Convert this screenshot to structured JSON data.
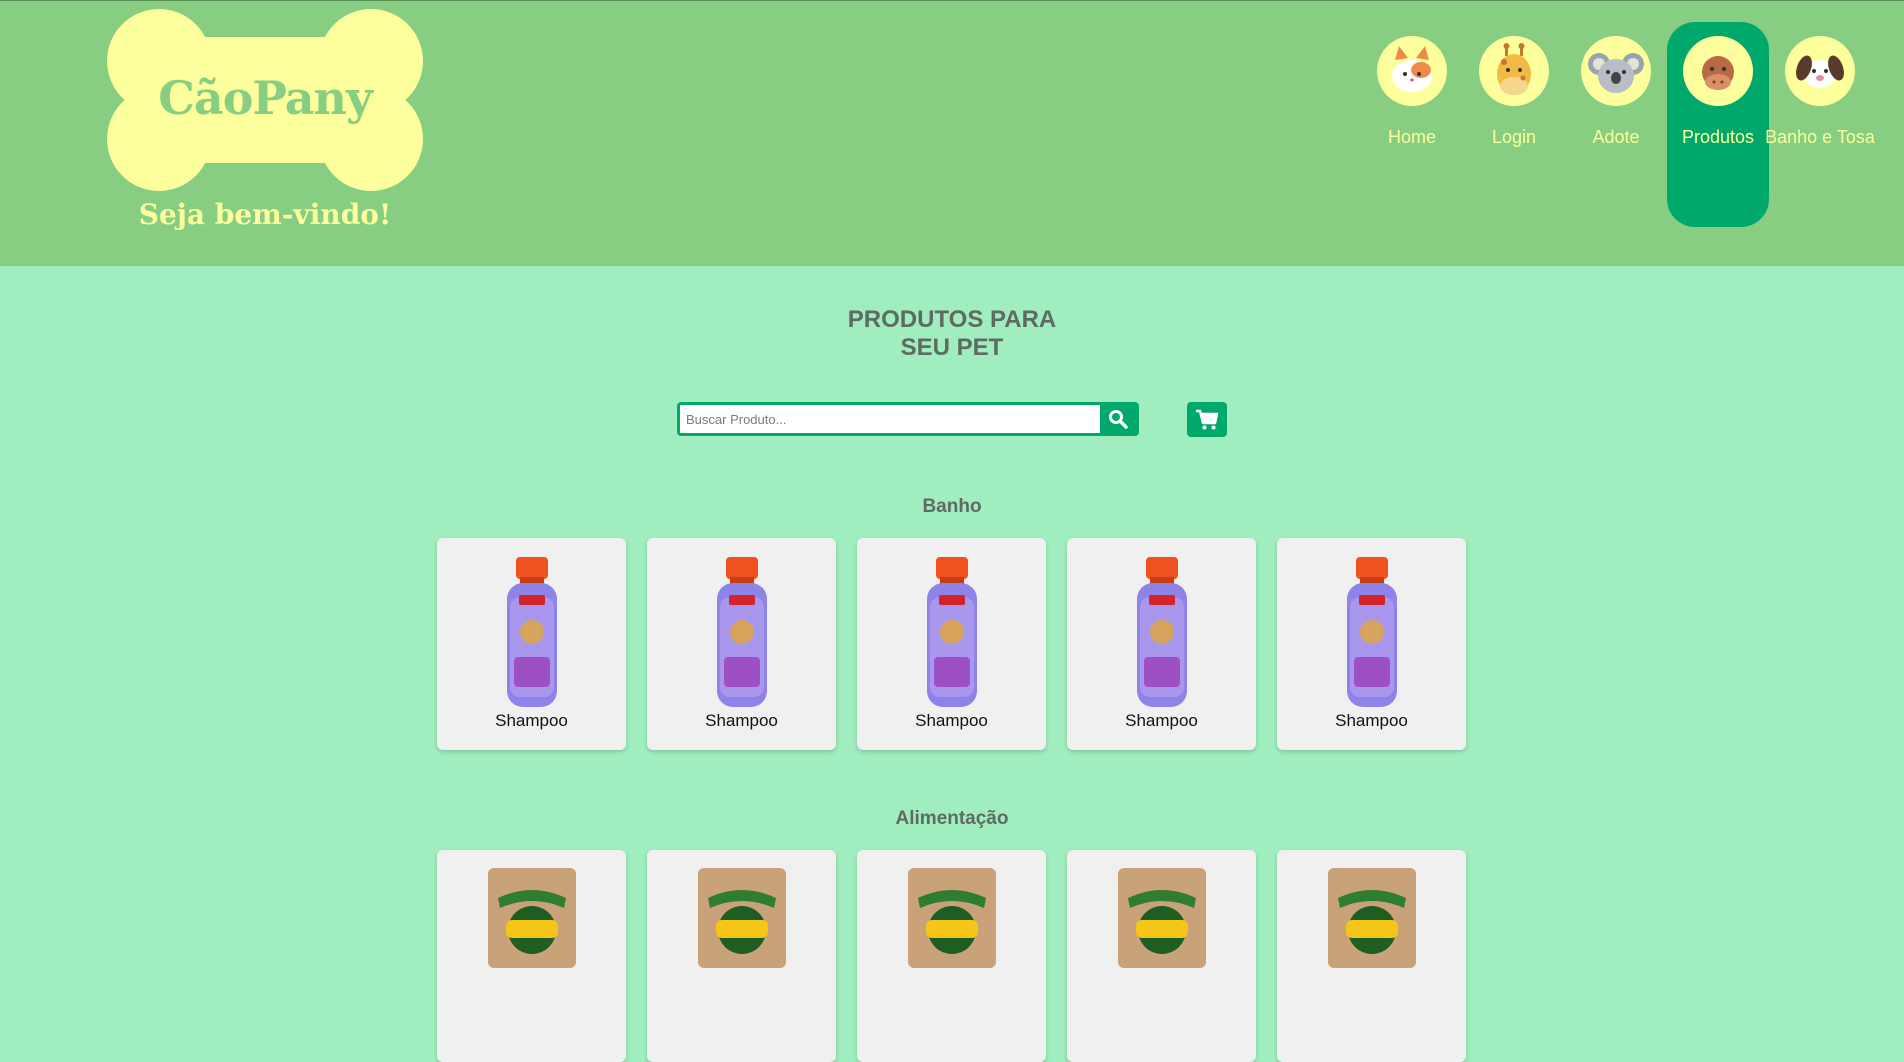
{
  "header": {
    "brand": "CãoPany",
    "welcome": "Seja bem-vindo!"
  },
  "nav": {
    "items": [
      {
        "label": "Home",
        "icon": "cat-face-icon"
      },
      {
        "label": "Login",
        "icon": "giraffe-face-icon"
      },
      {
        "label": "Adote",
        "icon": "koala-face-icon"
      },
      {
        "label": "Produtos",
        "icon": "cow-face-icon",
        "active": true
      },
      {
        "label": "Banho e Tosa",
        "icon": "dog-face-icon"
      }
    ]
  },
  "main": {
    "heading_line1": "PRODUTOS PARA",
    "heading_line2": "SEU PET",
    "search": {
      "placeholder": "Buscar Produto...",
      "value": ""
    },
    "sections": [
      {
        "title": "Banho",
        "products": [
          {
            "name": "Shampoo"
          },
          {
            "name": "Shampoo"
          },
          {
            "name": "Shampoo"
          },
          {
            "name": "Shampoo"
          },
          {
            "name": "Shampoo"
          }
        ]
      },
      {
        "title": "Alimentação",
        "products": [
          {},
          {},
          {},
          {},
          {}
        ]
      }
    ]
  },
  "colors": {
    "header_bg": "#87cd82",
    "page_bg": "#a0eebf",
    "accent": "#00a86b",
    "logo_yellow": "#fdff9c"
  }
}
